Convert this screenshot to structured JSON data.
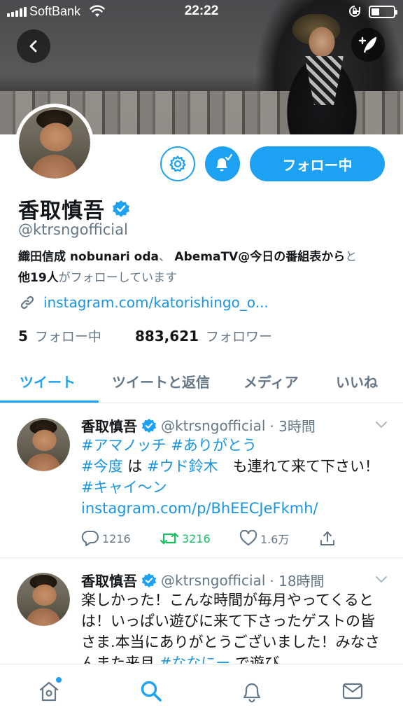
{
  "status_bar": {
    "carrier": "SoftBank",
    "time": "22:22",
    "battery_level": 0.35
  },
  "profile": {
    "display_name": "香取慎吾",
    "verified": true,
    "handle": "@ktrsngofficial",
    "followed_by": {
      "user_1": "織田信成 nobunari oda",
      "separator": "、",
      "user_2": "AbemaTV@今日の番組表から",
      "text_1": "と",
      "others": "他19人",
      "text_2": "がフォローしています"
    },
    "link": "instagram.com/katorishingo_o...",
    "following_count": "5",
    "following_label": "フォロー中",
    "followers_count": "883,621",
    "followers_label": "フォロワー",
    "follow_button_label": "フォロー中"
  },
  "tabs": [
    {
      "label": "ツイート",
      "active": true
    },
    {
      "label": "ツイートと返信",
      "active": false
    },
    {
      "label": "メディア",
      "active": false
    },
    {
      "label": "いいね",
      "active": false
    }
  ],
  "tweets": [
    {
      "name": "香取慎吾",
      "handle": "@ktrsngofficial",
      "time": "· 3時間",
      "body": {
        "hashtag_1": "#アマノッチ",
        "hashtag_2": "#ありがとう",
        "hashtag_3": "#今度",
        "text_1": " は ",
        "hashtag_4": "#ウド鈴木",
        "text_2": "　も連れて来て下さい！ ",
        "hashtag_5": "#キャイ〜ン",
        "link": "instagram.com/p/BhEECJeFkmh/"
      },
      "replies": "1216",
      "retweets": "3216",
      "likes": "1.6万"
    },
    {
      "name": "香取慎吾",
      "handle": "@ktrsngofficial",
      "time": "· 18時間",
      "body": {
        "text_1": "楽しかった！こんな時間が毎月やってくるとは！いっぱい遊びに来て下さったゲストの皆さま.本当にありがとうございました！みなさんまた来月 ",
        "hashtag_1": "#ななにー",
        "text_2": " で遊び"
      }
    }
  ],
  "colors": {
    "accent": "#1da1f2",
    "link": "#1b95e0",
    "retweet": "#17bf63",
    "secondary_text": "#657786"
  }
}
